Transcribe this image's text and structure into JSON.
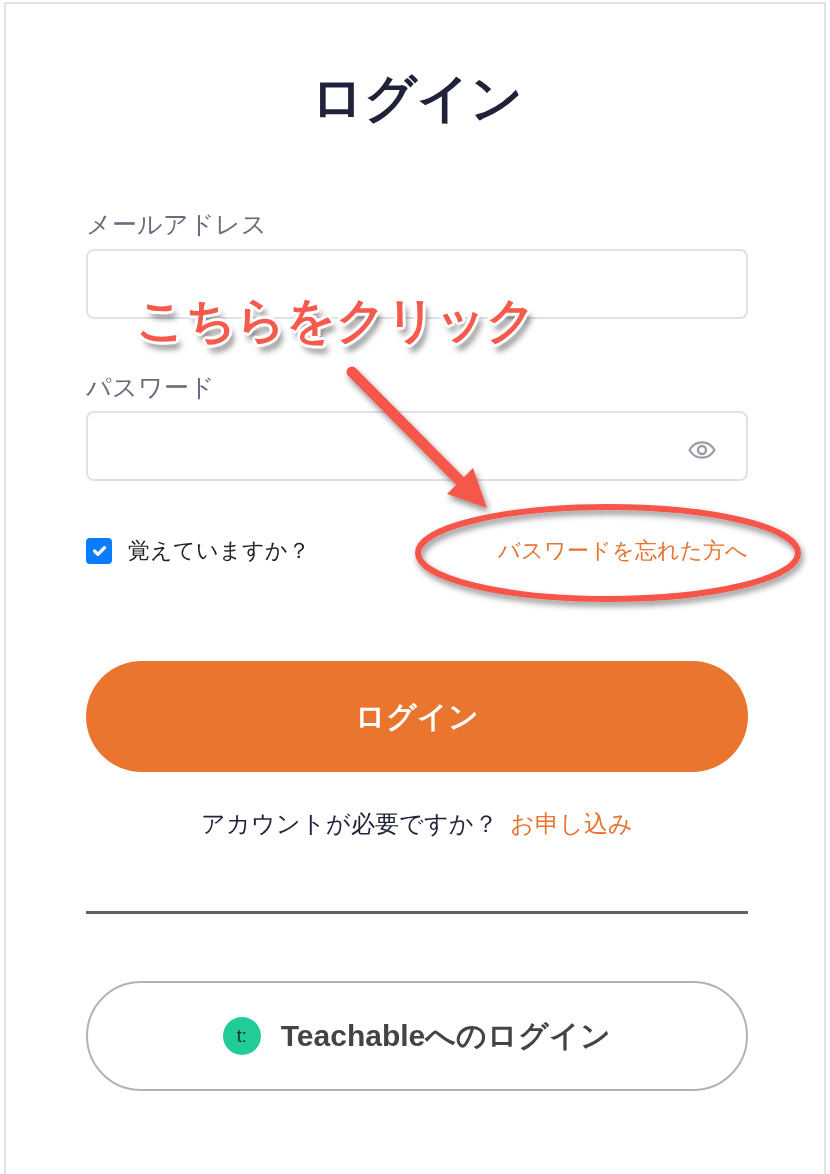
{
  "title": "ログイン",
  "email": {
    "label": "メールアドレス"
  },
  "password": {
    "label": "パスワード"
  },
  "remember": {
    "label": "覚えていますか？",
    "checked": true
  },
  "forgot_link": "バスワードを忘れた方へ",
  "login_button": "ログイン",
  "signup": {
    "question": "アカウントが必要ですか？",
    "link": "お申し込み"
  },
  "teachable_button": {
    "logo_text": "t:",
    "label": "Teachableへのログイン"
  },
  "annotation": {
    "text": "こちらをクリック"
  }
}
